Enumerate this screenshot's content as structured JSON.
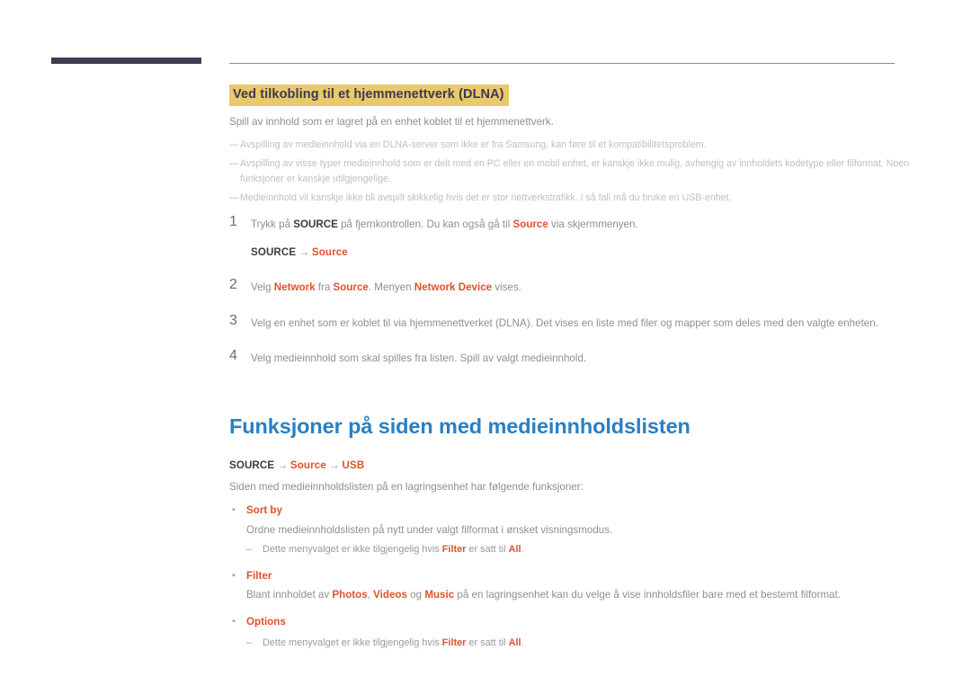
{
  "header": {
    "bar_color": "#413c52",
    "rule_color": "#8d8d8d"
  },
  "colors": {
    "accent_orange": "#e0522a",
    "heading_blue": "#2980c4",
    "highlight_bg": "#e9c96a",
    "highlight_fg": "#3d3855",
    "body_gray": "#8f8f8f",
    "note_gray": "#bfbfc6",
    "dark_text": "#3c3c3c"
  },
  "section_dlna": {
    "heading": "Ved tilkobling til et hjemmenettverk (DLNA)",
    "lead": "Spill av innhold som er lagret på en enhet koblet til et hjemmenettverk.",
    "dash_glyph": "—",
    "notes": [
      "Avspilling av medieinnhold via en DLNA-server som ikke er fra Samsung, kan føre til et kompatibilitetsproblem.",
      "Avspilling av visse typer medieinnhold som er delt med en PC eller en mobil enhet, er kanskje ikke mulig, avhengig av innholdets kodetype eller filformat. Noen funksjoner er kanskje utilgjengelige.",
      "Medieinnhold vil kanskje ikke bli avspilt skikkelig hvis det er stor nettverkstrafikk. I så fall må du bruke en USB-enhet."
    ],
    "steps": [
      {
        "num": "1",
        "pre": "Trykk på ",
        "b1": "SOURCE",
        "mid": " på fjernkontrollen. Du kan også gå til ",
        "b2": "Source",
        "post": " via skjermmenyen.",
        "path": {
          "root": "SOURCE",
          "arrow": "→",
          "node1": "Source"
        }
      },
      {
        "num": "2",
        "pre": "Velg ",
        "b1": "Network",
        "mid": " fra ",
        "b2": "Source",
        "mid2": ". Menyen ",
        "b3": "Network Device",
        "post": " vises."
      },
      {
        "num": "3",
        "text": "Velg en enhet som er koblet til via hjemmenettverket (DLNA). Det vises en liste med filer og mapper som deles med den valgte enheten."
      },
      {
        "num": "4",
        "text": "Velg medieinnhold som skal spilles fra listen. Spill av valgt medieinnhold."
      }
    ]
  },
  "section_media_list": {
    "heading": "Funksjoner på siden med medieinnholdslisten",
    "path": {
      "root": "SOURCE",
      "arrow": "→",
      "node1": "Source",
      "node2": "USB"
    },
    "lead": "Siden med medieinnholdslisten på en lagringsenhet har følgende funksjoner:",
    "bullet_glyph": "▪",
    "subdash_glyph": "–",
    "items": [
      {
        "title": "Sort by",
        "desc": "Ordne medieinnholdslisten på nytt under valgt filformat i ønsket visningsmodus.",
        "subnote": {
          "pre": "Dette menyvalget er ikke tilgjengelig hvis ",
          "b1": "Filter",
          "mid": " er satt til ",
          "b2": "All",
          "post": "."
        }
      },
      {
        "title": "Filter",
        "desc_pre": "Blant innholdet av ",
        "desc_b1": "Photos",
        "desc_mid1": ", ",
        "desc_b2": "Videos",
        "desc_mid2": " og ",
        "desc_b3": "Music",
        "desc_post": " på en lagringsenhet kan du velge å vise innholdsfiler bare med et bestemt filformat."
      },
      {
        "title": "Options",
        "subnote": {
          "pre": "Dette menyvalget er ikke tilgjengelig hvis ",
          "b1": "Filter",
          "mid": " er satt til ",
          "b2": "All",
          "post": "."
        }
      }
    ]
  }
}
